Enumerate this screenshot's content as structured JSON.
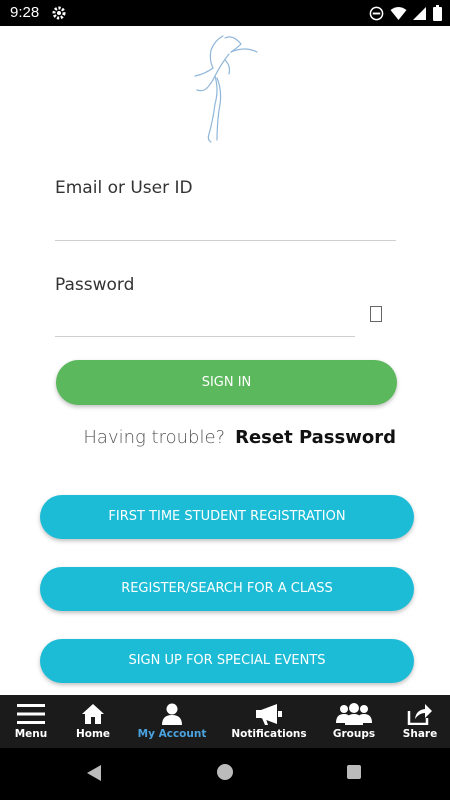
{
  "status_bar": {
    "time": "9:28"
  },
  "form": {
    "email_label": "Email or User ID",
    "email_value": "",
    "password_label": "Password",
    "password_value": "",
    "password_toggle_glyph": "▯",
    "sign_in_label": "SIGN IN",
    "trouble_text": "Having trouble?",
    "reset_label": "Reset Password"
  },
  "actions": {
    "first_time_label": "FIRST TIME STUDENT REGISTRATION",
    "register_search_label": "REGISTER/SEARCH FOR A CLASS",
    "special_events_label": "SIGN UP FOR SPECIAL EVENTS"
  },
  "bottom_nav": {
    "items": [
      {
        "label": "Menu",
        "icon": "hamburger-icon"
      },
      {
        "label": "Home",
        "icon": "home-icon"
      },
      {
        "label": "My Account",
        "icon": "person-icon",
        "active": true
      },
      {
        "label": "Notifications",
        "icon": "megaphone-icon"
      },
      {
        "label": "Groups",
        "icon": "group-icon"
      },
      {
        "label": "Share",
        "icon": "share-icon"
      }
    ]
  },
  "colors": {
    "sign_in": "#5cb85c",
    "action_buttons": "#1cbcd6",
    "nav_active": "#4aa3df",
    "nav_background": "#1b1b1b"
  }
}
